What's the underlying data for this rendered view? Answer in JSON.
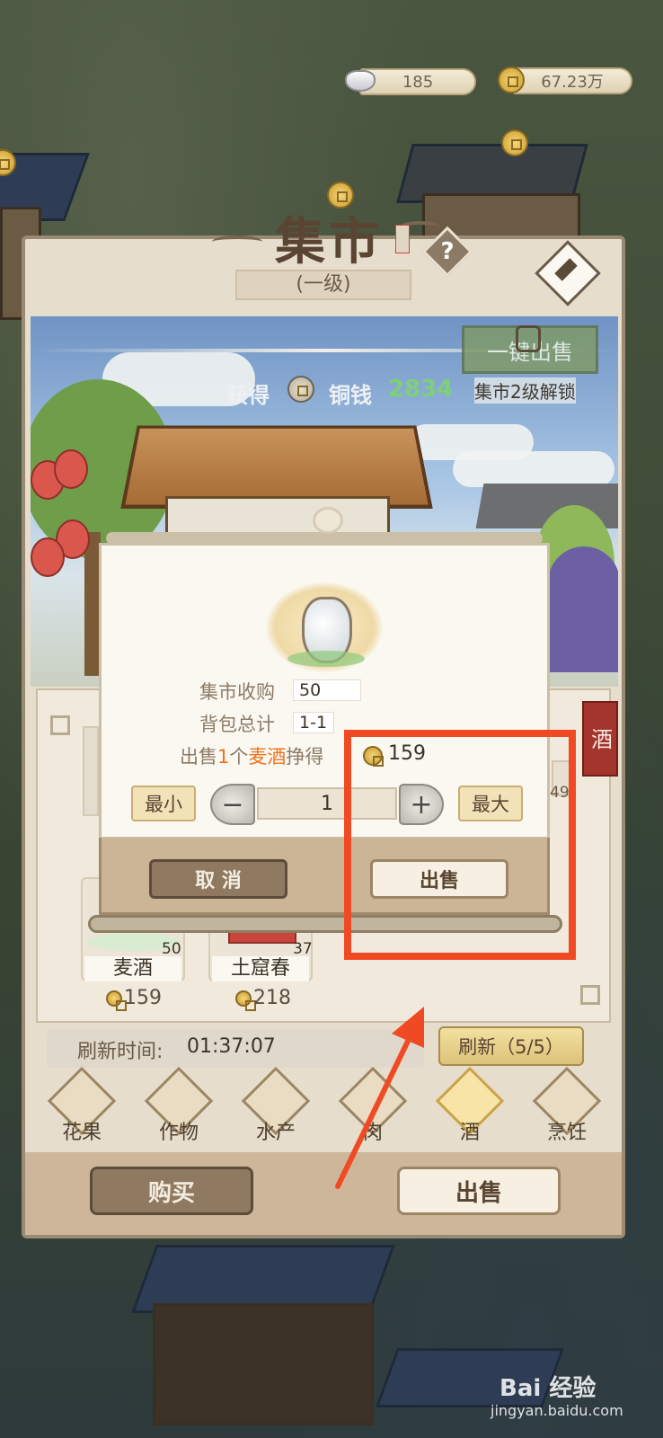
{
  "currency": {
    "silver": "185",
    "copper": "67.23万"
  },
  "header": {
    "title": "集市",
    "level": "(一级)"
  },
  "earnings": {
    "label_get": "获得",
    "label_coin": "铜钱",
    "amount": "2834"
  },
  "oneclick": {
    "label": "一键出售",
    "lock_text": "集市2级解锁"
  },
  "side_tag": "酒",
  "dialog": {
    "purchase_label": "集市收购",
    "purchase_value": "50",
    "bag_label": "背包总计",
    "bag_value": "1-1",
    "sell_prefix": "出售",
    "sell_qty": "1",
    "sell_unit": "个",
    "sell_item": "麦酒",
    "sell_earn": "挣得",
    "sell_price": "159",
    "min_label": "最小",
    "max_label": "最大",
    "quantity": "1",
    "cancel_label": "取 消",
    "confirm_label": "出售"
  },
  "items": [
    {
      "name": "麦酒",
      "count": "50",
      "price": "159"
    },
    {
      "name": "土窟春",
      "count": "37",
      "price": "218"
    }
  ],
  "partial_count": "49",
  "refresh": {
    "label": "刷新时间:",
    "time": "01:37:07",
    "button": "刷新（5/5）"
  },
  "tabs": [
    {
      "label": "花果",
      "icon": "fruit-icon"
    },
    {
      "label": "作物",
      "icon": "wheat-icon"
    },
    {
      "label": "水产",
      "icon": "crab-icon"
    },
    {
      "label": "肉",
      "icon": "meat-icon"
    },
    {
      "label": "酒",
      "icon": "wine-jar-icon"
    },
    {
      "label": "烹饪",
      "icon": "cooking-icon"
    }
  ],
  "bottom": {
    "buy": "购买",
    "sell": "出售"
  },
  "watermark": {
    "brand": "Bai 经验",
    "url": "jingyan.baidu.com"
  },
  "colors": {
    "accent_green": "#7fcf7a",
    "highlight_orange": "#f0731c",
    "annotation_red": "#f04a24"
  }
}
